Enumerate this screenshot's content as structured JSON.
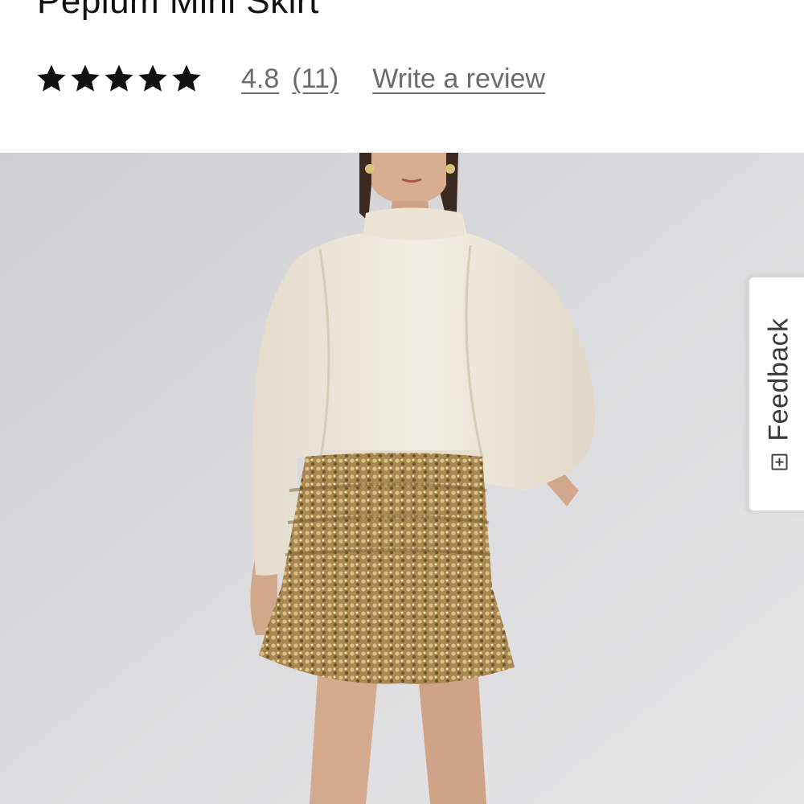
{
  "product": {
    "title": "Peplum Mini Skirt",
    "rating": {
      "stars_filled": 5,
      "stars_total": 5,
      "value": "4.8",
      "count": "(11)",
      "write_review_label": "Write a review"
    }
  },
  "hero_image": {
    "subject": "model-wearing-cream-sweater-and-gold-sequin-skirt",
    "colors": {
      "background": "#d9d9db",
      "sweater": "#efe9dc",
      "skirt": "#a88a57",
      "skin": "#d2a88c",
      "hair": "#3b2a22"
    }
  },
  "feedback": {
    "label": "Feedback",
    "icon": "plus-box-icon"
  },
  "colors": {
    "text": "#111111",
    "link": "#6b6b6b",
    "star": "#111111"
  }
}
